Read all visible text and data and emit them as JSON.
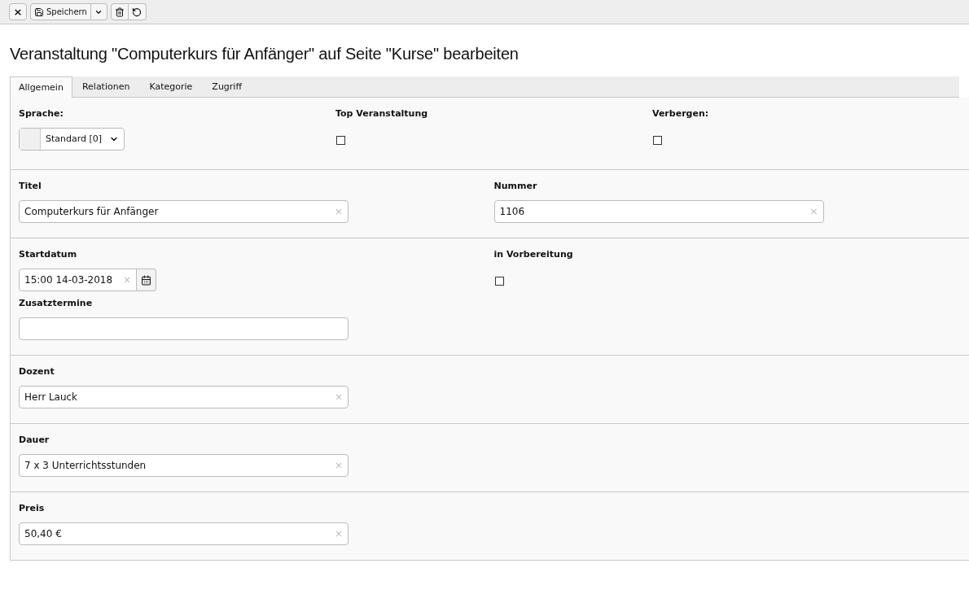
{
  "toolbar": {
    "close": "×",
    "save": "Speichern"
  },
  "title": "Veranstaltung \"Computerkurs für Anfänger\" auf Seite \"Kurse\" bearbeiten",
  "tabs": [
    {
      "label": "Allgemein",
      "selected": true
    },
    {
      "label": "Relationen",
      "selected": false
    },
    {
      "label": "Kategorie",
      "selected": false
    },
    {
      "label": "Zugriff",
      "selected": false
    }
  ],
  "sections": [
    {
      "columns": [
        [
          {
            "kind": "select",
            "label": "Sprache:",
            "value": "Standard [0]"
          }
        ],
        [
          {
            "kind": "checkbox",
            "label": "Top Veranstaltung",
            "checked": false
          }
        ],
        [
          {
            "kind": "checkbox",
            "label": "Verbergen:",
            "checked": false
          }
        ]
      ]
    },
    {
      "columns": [
        [
          {
            "kind": "text",
            "label": "Titel",
            "value": "Computerkurs für Anfänger",
            "clear": "×"
          }
        ],
        [
          {
            "kind": "text",
            "label": "Nummer",
            "value": "1106",
            "clear": "×"
          }
        ]
      ]
    },
    {
      "columns": [
        [
          {
            "kind": "date",
            "label": "Startdatum",
            "value": "15:00 14-03-2018",
            "clear": "×"
          },
          {
            "kind": "text",
            "label": "Zusatztermine"
          }
        ],
        [
          {
            "kind": "checkbox",
            "label": "in Vorbereitung",
            "checked": false
          }
        ]
      ]
    },
    {
      "columns": [
        [
          {
            "kind": "text",
            "label": "Dozent",
            "value": "Herr Lauck",
            "clear": "×"
          }
        ]
      ]
    },
    {
      "columns": [
        [
          {
            "kind": "text",
            "label": "Dauer",
            "value": "7 x 3 Unterrichtsstunden",
            "clear": "×"
          }
        ]
      ]
    },
    {
      "columns": [
        [
          {
            "kind": "text",
            "label": "Preis",
            "value": "50,40 €",
            "clear": "×"
          }
        ]
      ]
    }
  ]
}
